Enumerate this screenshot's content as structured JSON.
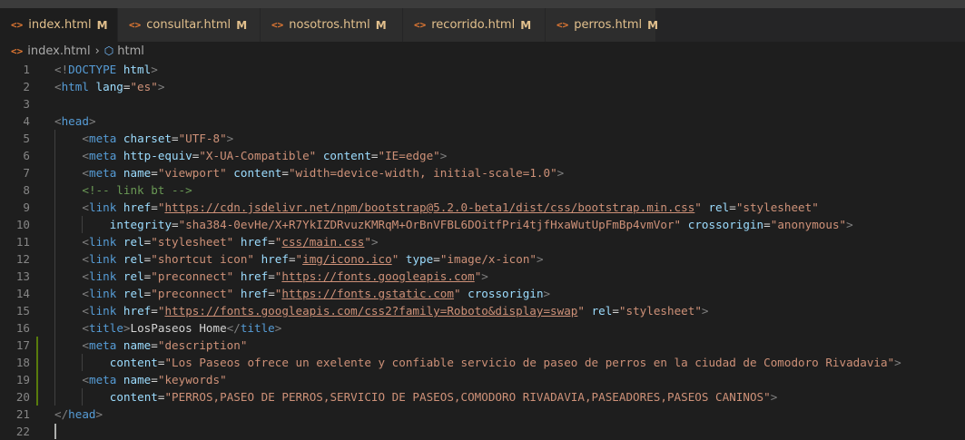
{
  "tabs": [
    {
      "name": "index.html",
      "mod": "M",
      "active": true
    },
    {
      "name": "consultar.html",
      "mod": "M",
      "active": false
    },
    {
      "name": "nosotros.html",
      "mod": "M",
      "active": false
    },
    {
      "name": "recorrido.html",
      "mod": "M",
      "active": false
    },
    {
      "name": "perros.html",
      "mod": "M",
      "active": false
    }
  ],
  "tab_close": "×",
  "file_icon": "<>",
  "breadcrumb": {
    "file": "index.html",
    "symbol": "html"
  },
  "lines": [
    {
      "n": "1",
      "tokens": [
        [
          "t",
          "<!"
        ],
        [
          "tg",
          "DOCTYPE"
        ],
        [
          "tx",
          " "
        ],
        [
          "at",
          "html"
        ],
        [
          "t",
          ">"
        ]
      ]
    },
    {
      "n": "2",
      "tokens": [
        [
          "t",
          "<"
        ],
        [
          "tg",
          "html"
        ],
        [
          "tx",
          " "
        ],
        [
          "at",
          "lang"
        ],
        [
          "tx",
          "="
        ],
        [
          "v",
          "\"es\""
        ],
        [
          "t",
          ">"
        ]
      ]
    },
    {
      "n": "3",
      "tokens": []
    },
    {
      "n": "4",
      "tokens": [
        [
          "t",
          "<"
        ],
        [
          "tg",
          "head"
        ],
        [
          "t",
          ">"
        ]
      ]
    },
    {
      "n": "5",
      "indent": 1,
      "tokens": [
        [
          "t",
          "<"
        ],
        [
          "tg",
          "meta"
        ],
        [
          "tx",
          " "
        ],
        [
          "at",
          "charset"
        ],
        [
          "tx",
          "="
        ],
        [
          "v",
          "\"UTF-8\""
        ],
        [
          "t",
          ">"
        ]
      ]
    },
    {
      "n": "6",
      "indent": 1,
      "tokens": [
        [
          "t",
          "<"
        ],
        [
          "tg",
          "meta"
        ],
        [
          "tx",
          " "
        ],
        [
          "at",
          "http-equiv"
        ],
        [
          "tx",
          "="
        ],
        [
          "v",
          "\"X-UA-Compatible\""
        ],
        [
          "tx",
          " "
        ],
        [
          "at",
          "content"
        ],
        [
          "tx",
          "="
        ],
        [
          "v",
          "\"IE=edge\""
        ],
        [
          "t",
          ">"
        ]
      ]
    },
    {
      "n": "7",
      "indent": 1,
      "tokens": [
        [
          "t",
          "<"
        ],
        [
          "tg",
          "meta"
        ],
        [
          "tx",
          " "
        ],
        [
          "at",
          "name"
        ],
        [
          "tx",
          "="
        ],
        [
          "v",
          "\"viewport\""
        ],
        [
          "tx",
          " "
        ],
        [
          "at",
          "content"
        ],
        [
          "tx",
          "="
        ],
        [
          "v",
          "\"width=device-width, initial-scale=1.0\""
        ],
        [
          "t",
          ">"
        ]
      ]
    },
    {
      "n": "8",
      "indent": 1,
      "tokens": [
        [
          "cm",
          "<!-- link bt -->"
        ]
      ]
    },
    {
      "n": "9",
      "indent": 1,
      "tokens": [
        [
          "t",
          "<"
        ],
        [
          "tg",
          "link"
        ],
        [
          "tx",
          " "
        ],
        [
          "at",
          "href"
        ],
        [
          "tx",
          "="
        ],
        [
          "v",
          "\""
        ],
        [
          "vu",
          "https://cdn.jsdelivr.net/npm/bootstrap@5.2.0-beta1/dist/css/bootstrap.min.css"
        ],
        [
          "v",
          "\""
        ],
        [
          "tx",
          " "
        ],
        [
          "at",
          "rel"
        ],
        [
          "tx",
          "="
        ],
        [
          "v",
          "\"stylesheet\""
        ]
      ]
    },
    {
      "n": "10",
      "indent": 2,
      "tokens": [
        [
          "at",
          "integrity"
        ],
        [
          "tx",
          "="
        ],
        [
          "v",
          "\"sha384-0evHe/X+R7YkIZDRvuzKMRqM+OrBnVFBL6DOitfPri4tjfHxaWutUpFmBp4vmVor\""
        ],
        [
          "tx",
          " "
        ],
        [
          "at",
          "crossorigin"
        ],
        [
          "tx",
          "="
        ],
        [
          "v",
          "\"anonymous\""
        ],
        [
          "t",
          ">"
        ]
      ]
    },
    {
      "n": "11",
      "indent": 1,
      "tokens": [
        [
          "t",
          "<"
        ],
        [
          "tg",
          "link"
        ],
        [
          "tx",
          " "
        ],
        [
          "at",
          "rel"
        ],
        [
          "tx",
          "="
        ],
        [
          "v",
          "\"stylesheet\""
        ],
        [
          "tx",
          " "
        ],
        [
          "at",
          "href"
        ],
        [
          "tx",
          "="
        ],
        [
          "v",
          "\""
        ],
        [
          "vu",
          "css/main.css"
        ],
        [
          "v",
          "\""
        ],
        [
          "t",
          ">"
        ]
      ]
    },
    {
      "n": "12",
      "indent": 1,
      "tokens": [
        [
          "t",
          "<"
        ],
        [
          "tg",
          "link"
        ],
        [
          "tx",
          " "
        ],
        [
          "at",
          "rel"
        ],
        [
          "tx",
          "="
        ],
        [
          "v",
          "\"shortcut icon\""
        ],
        [
          "tx",
          " "
        ],
        [
          "at",
          "href"
        ],
        [
          "tx",
          "="
        ],
        [
          "v",
          "\""
        ],
        [
          "vu",
          "img/icono.ico"
        ],
        [
          "v",
          "\""
        ],
        [
          "tx",
          " "
        ],
        [
          "at",
          "type"
        ],
        [
          "tx",
          "="
        ],
        [
          "v",
          "\"image/x-icon\""
        ],
        [
          "t",
          ">"
        ]
      ]
    },
    {
      "n": "13",
      "indent": 1,
      "tokens": [
        [
          "t",
          "<"
        ],
        [
          "tg",
          "link"
        ],
        [
          "tx",
          " "
        ],
        [
          "at",
          "rel"
        ],
        [
          "tx",
          "="
        ],
        [
          "v",
          "\"preconnect\""
        ],
        [
          "tx",
          " "
        ],
        [
          "at",
          "href"
        ],
        [
          "tx",
          "="
        ],
        [
          "v",
          "\""
        ],
        [
          "vu",
          "https://fonts.googleapis.com"
        ],
        [
          "v",
          "\""
        ],
        [
          "t",
          ">"
        ]
      ]
    },
    {
      "n": "14",
      "indent": 1,
      "tokens": [
        [
          "t",
          "<"
        ],
        [
          "tg",
          "link"
        ],
        [
          "tx",
          " "
        ],
        [
          "at",
          "rel"
        ],
        [
          "tx",
          "="
        ],
        [
          "v",
          "\"preconnect\""
        ],
        [
          "tx",
          " "
        ],
        [
          "at",
          "href"
        ],
        [
          "tx",
          "="
        ],
        [
          "v",
          "\""
        ],
        [
          "vu",
          "https://fonts.gstatic.com"
        ],
        [
          "v",
          "\""
        ],
        [
          "tx",
          " "
        ],
        [
          "at",
          "crossorigin"
        ],
        [
          "t",
          ">"
        ]
      ]
    },
    {
      "n": "15",
      "indent": 1,
      "tokens": [
        [
          "t",
          "<"
        ],
        [
          "tg",
          "link"
        ],
        [
          "tx",
          " "
        ],
        [
          "at",
          "href"
        ],
        [
          "tx",
          "="
        ],
        [
          "v",
          "\""
        ],
        [
          "vu",
          "https://fonts.googleapis.com/css2?family=Roboto&display=swap"
        ],
        [
          "v",
          "\""
        ],
        [
          "tx",
          " "
        ],
        [
          "at",
          "rel"
        ],
        [
          "tx",
          "="
        ],
        [
          "v",
          "\"stylesheet\""
        ],
        [
          "t",
          ">"
        ]
      ]
    },
    {
      "n": "16",
      "indent": 1,
      "tokens": [
        [
          "t",
          "<"
        ],
        [
          "tg",
          "title"
        ],
        [
          "t",
          ">"
        ],
        [
          "tx",
          "LosPaseos Home"
        ],
        [
          "t",
          "</"
        ],
        [
          "tg",
          "title"
        ],
        [
          "t",
          ">"
        ]
      ]
    },
    {
      "n": "17",
      "indent": 1,
      "modified": true,
      "tokens": [
        [
          "t",
          "<"
        ],
        [
          "tg",
          "meta"
        ],
        [
          "tx",
          " "
        ],
        [
          "at",
          "name"
        ],
        [
          "tx",
          "="
        ],
        [
          "v",
          "\"description\""
        ]
      ]
    },
    {
      "n": "18",
      "indent": 2,
      "modified": true,
      "tokens": [
        [
          "at",
          "content"
        ],
        [
          "tx",
          "="
        ],
        [
          "v",
          "\"Los Paseos ofrece un exelente y confiable servicio de paseo de perros en la ciudad de Comodoro Rivadavia\""
        ],
        [
          "t",
          ">"
        ]
      ]
    },
    {
      "n": "19",
      "indent": 1,
      "modified": true,
      "tokens": [
        [
          "t",
          "<"
        ],
        [
          "tg",
          "meta"
        ],
        [
          "tx",
          " "
        ],
        [
          "at",
          "name"
        ],
        [
          "tx",
          "="
        ],
        [
          "v",
          "\"keywords\""
        ]
      ]
    },
    {
      "n": "20",
      "indent": 2,
      "modified": true,
      "tokens": [
        [
          "at",
          "content"
        ],
        [
          "tx",
          "="
        ],
        [
          "v",
          "\"PERROS,PASEO DE PERROS,SERVICIO DE PASEOS,COMODORO RIVADAVIA,PASEADORES,PASEOS CANINOS\""
        ],
        [
          "t",
          ">"
        ]
      ]
    },
    {
      "n": "21",
      "tokens": [
        [
          "t",
          "</"
        ],
        [
          "tg",
          "head"
        ],
        [
          "t",
          ">"
        ]
      ]
    },
    {
      "n": "22",
      "cursor": true,
      "tokens": []
    }
  ]
}
